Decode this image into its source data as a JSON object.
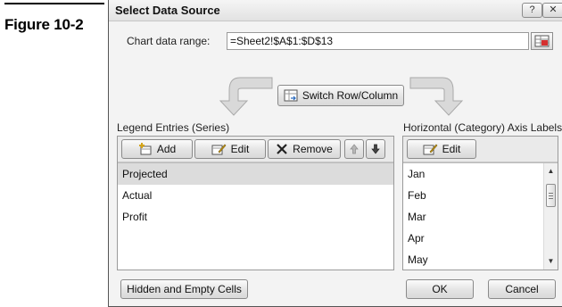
{
  "figure": {
    "label": "Figure 10-2"
  },
  "dialog": {
    "title": "Select Data Source",
    "help_glyph": "?",
    "close_glyph": "✕",
    "range_label": "Chart data range:",
    "range_value": "=Sheet2!$A$1:$D$13",
    "switch_label": "Switch Row/Column",
    "legend": {
      "heading": "Legend Entries (Series)",
      "add_label": "Add",
      "edit_label": "Edit",
      "remove_label": "Remove",
      "items": [
        "Projected",
        "Actual",
        "Profit"
      ],
      "selected_index": 0
    },
    "axis": {
      "heading": "Horizontal (Category) Axis Labels",
      "edit_label": "Edit",
      "items": [
        "Jan",
        "Feb",
        "Mar",
        "Apr",
        "May"
      ]
    },
    "hidden_cells_label": "Hidden and Empty Cells",
    "ok_label": "OK",
    "cancel_label": "Cancel"
  },
  "colors": {
    "dialog_bg": "#f3f3f3",
    "selection": "#dcdcdc",
    "remove_icon": "#222222",
    "arrow_fill": "#d9d9d9"
  }
}
